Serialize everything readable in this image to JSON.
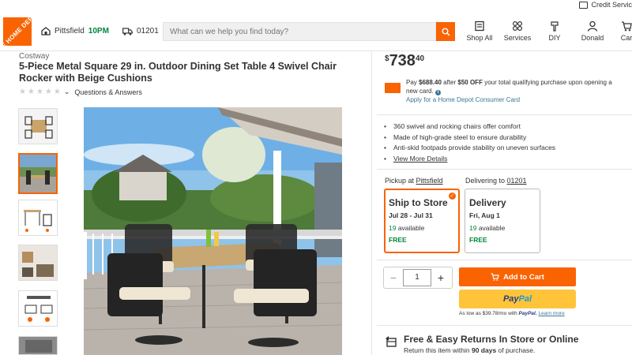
{
  "header": {
    "logo_text": "THE HOME DEPOT",
    "credit_link": "Credit Servic",
    "store_name": "Pittsfield",
    "store_hours": "10PM",
    "zip": "01201",
    "search_placeholder": "What can we help you find today?",
    "nav": [
      {
        "label": "Shop All",
        "icon": "grid-list-icon"
      },
      {
        "label": "Services",
        "icon": "services-icon"
      },
      {
        "label": "DIY",
        "icon": "diy-icon"
      },
      {
        "label": "Donald",
        "icon": "user-icon"
      },
      {
        "label": "Car",
        "icon": "cart-icon"
      }
    ],
    "accent": "#f96302"
  },
  "product": {
    "brand": "Costway",
    "title": "5-Piece Metal Square 29 in. Outdoor Dining Set Table 4 Swivel Chair Rocker with Beige Cushions",
    "rating_stars": 0,
    "qa_link": "Questions & Answers"
  },
  "pricing": {
    "currency": "$",
    "dollars": "738",
    "cents": "40",
    "promo_pay_prefix": "Pay ",
    "promo_pay_amount": "$688.40",
    "promo_after": " after ",
    "promo_off": "$50 OFF",
    "promo_rest": " your total qualifying purchase upon opening a new card.",
    "promo_link": "Apply for a Home Depot Consumer Card"
  },
  "highlights": [
    "360 swivel and rocking chairs offer comfort",
    "Made of high-grade steel to ensure durability",
    "Anti-skid footpads provide stability on uneven surfaces"
  ],
  "view_more": "View More Details",
  "fulfillment": {
    "pickup_label": "Pickup at ",
    "pickup_store": "Pittsfield",
    "delivery_label": "Delivering to ",
    "delivery_zip": "01201",
    "options": [
      {
        "title": "Ship to Store",
        "dates": "Jul 28 - Jul 31",
        "count": "19",
        "avail": " available",
        "price": "FREE",
        "selected": true
      },
      {
        "title": "Delivery",
        "dates": "Fri, Aug 1",
        "count": "19",
        "avail": " available",
        "price": "FREE",
        "selected": false
      }
    ]
  },
  "cart": {
    "quantity": "1",
    "minus": "−",
    "plus": "+",
    "add_label": "Add to Cart",
    "paypal_1": "Pay",
    "paypal_2": "Pal",
    "pp_note_prefix": "As low as $39.78/mo with ",
    "pp_note_brand": "PayPal.",
    "pp_note_link": "Learn more"
  },
  "returns": {
    "title": "Free & Easy Returns In Store or Online",
    "sub_prefix": "Return this item within ",
    "sub_days": "90 days",
    "sub_suffix": " of purchase."
  }
}
